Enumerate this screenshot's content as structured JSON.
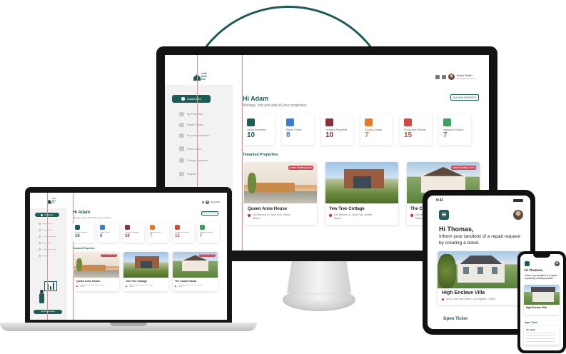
{
  "app": {
    "logo_text": "rent\nlord\ninc"
  },
  "user": {
    "name": "Adam Smith",
    "email": "adam@rentlord.com"
  },
  "sidebar": {
    "items": [
      {
        "label": "Dashboard",
        "icon": "dashboard-icon"
      },
      {
        "label": "My Properties",
        "icon": "home-icon"
      },
      {
        "label": "Repair Tickets",
        "icon": "wrench-icon"
      },
      {
        "label": "Property Inspection",
        "icon": "clipboard-icon"
      },
      {
        "label": "Lease Deals",
        "icon": "document-icon"
      },
      {
        "label": "Change Password",
        "icon": "lock-icon"
      },
      {
        "label": "Support",
        "icon": "chat-icon"
      }
    ]
  },
  "main": {
    "greeting": "Hi Adam",
    "subtitle": "Manage, edit and add all your properties",
    "add_button": "ADD NEW PROPERTY",
    "section_title": "Tenanted Properties"
  },
  "stats": [
    {
      "label": "Vacant Properties",
      "value": "10",
      "color": "#1d5c57",
      "icon": "key-icon"
    },
    {
      "label": "Repair Tickets",
      "value": "8",
      "color": "#3b7bd6",
      "icon": "tools-icon"
    },
    {
      "label": "Tenanted Properties",
      "value": "10",
      "color": "#8e2f3a",
      "icon": "tenant-icon"
    },
    {
      "label": "Expiring Leases",
      "value": "7",
      "color": "#e8782a",
      "icon": "hourglass-icon"
    },
    {
      "label": "Prospective Tenants",
      "value": "15",
      "color": "#d14b3c",
      "icon": "people-icon"
    },
    {
      "label": "Inspection Reports",
      "value": "7",
      "color": "#3aa35a",
      "icon": "report-icon"
    }
  ],
  "properties": [
    {
      "name": "Queen Anne House",
      "address": "245 Broome St, New York, United States",
      "badge": "Lease Expiring Soon"
    },
    {
      "name": "Yew Tree Cottage",
      "address": "245 Broome St, New York, United States",
      "badge": ""
    },
    {
      "name": "The Coach House",
      "address": "245 Broome St, New York, United States",
      "badge": "Lease Expiring Soon"
    }
  ],
  "laptop": {
    "sidebar_button": "Register new ticket"
  },
  "tablet": {
    "time": "9:41",
    "greeting": "Hi Thomas,",
    "message": "Inform your landlord of a repair request by creating a ticket.",
    "property_name": "High Enclave Villa",
    "property_address": "9223, 3rd Street West, Los Angeles - 90002",
    "section": "Open Ticket"
  },
  "phone": {
    "greeting": "Hi Thomas,",
    "message": "Inform your landlord of a repair request by creating a ticket.",
    "property_name": "High Enclave Villa",
    "section": "Open Ticket",
    "ticket_title": "AC repair"
  }
}
